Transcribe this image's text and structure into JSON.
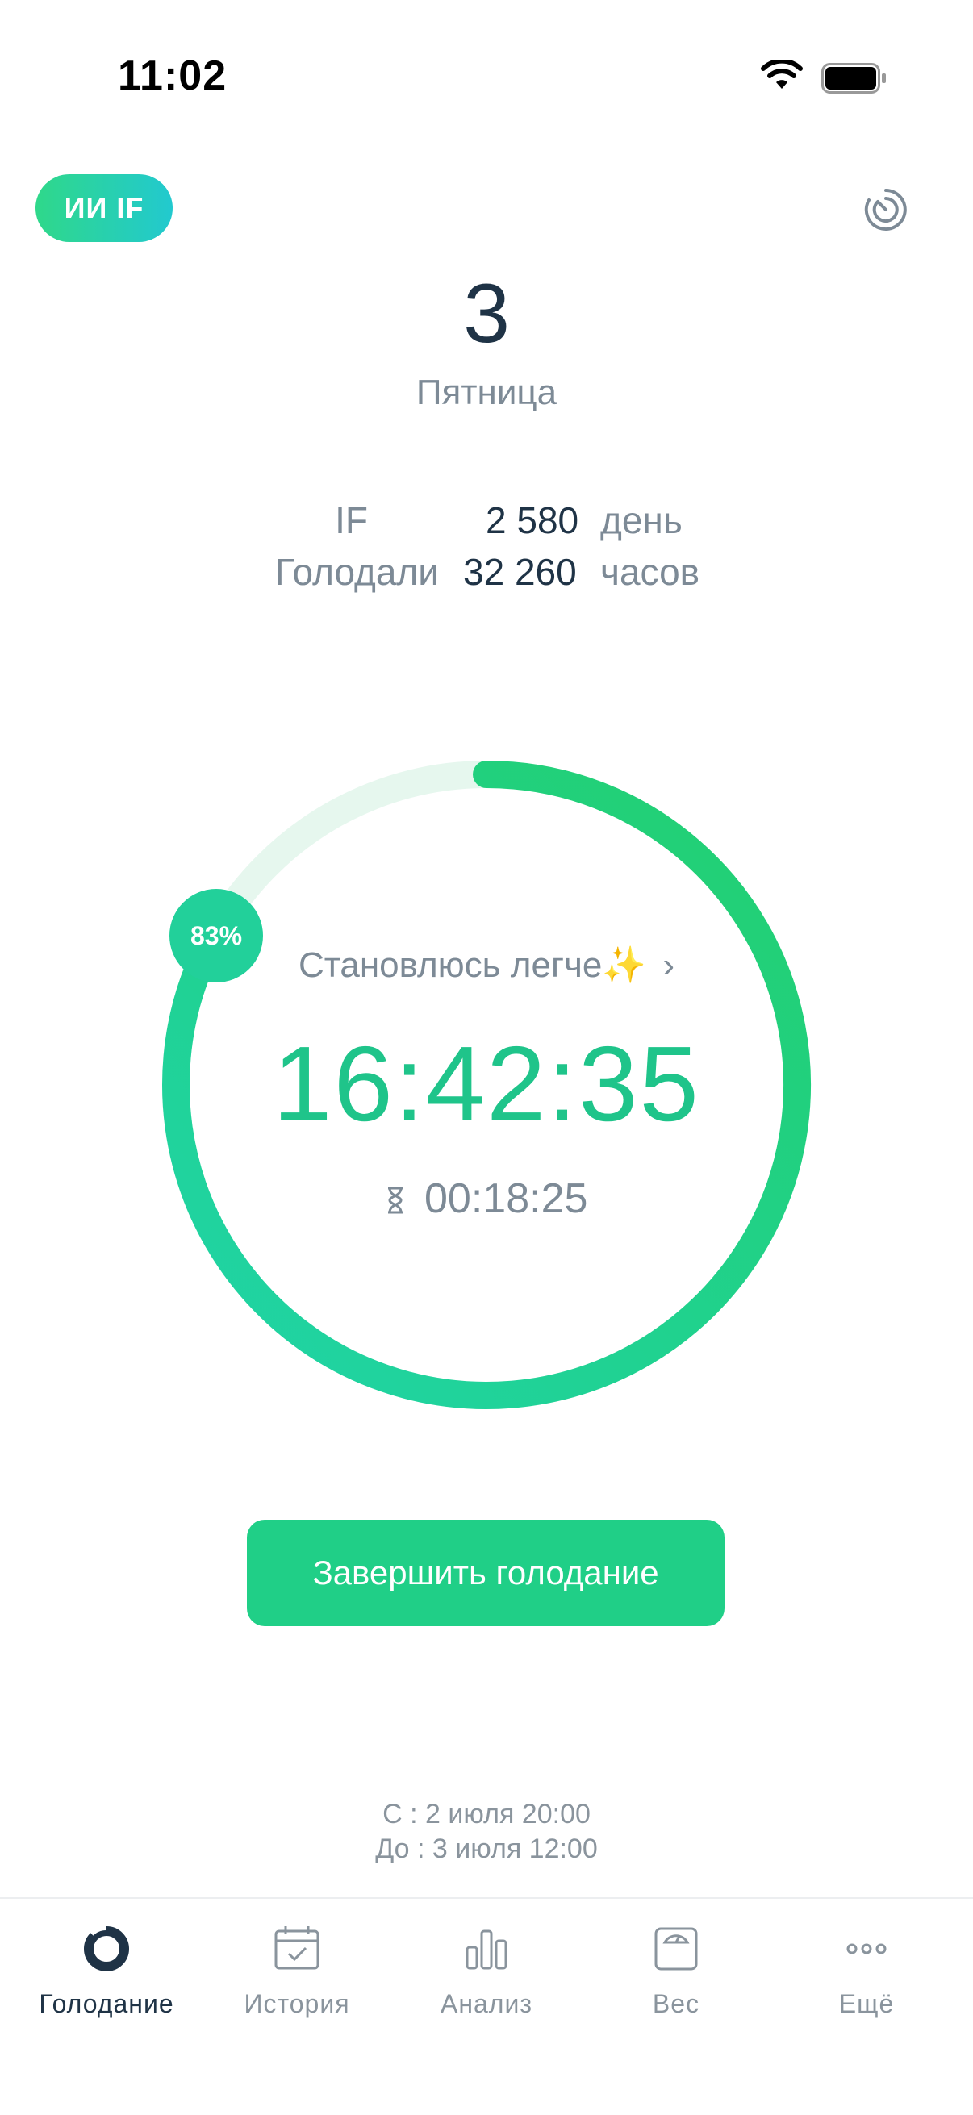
{
  "status_bar": {
    "time": "11:02"
  },
  "header": {
    "ai_badge": "ИИ IF",
    "history_icon": "history-timer-icon"
  },
  "day": {
    "number": "3",
    "weekday": "Пятница"
  },
  "stats": {
    "if_label": "IF",
    "if_value": "2 580",
    "if_unit": "день",
    "fasted_label": "Голодали",
    "fasted_value": "32 260",
    "fasted_unit": "часов"
  },
  "ring": {
    "percent_label": "83%",
    "progress": 0.83,
    "mood": "Становлюсь легче✨",
    "mood_chevron": "›",
    "elapsed": "16:42:35",
    "remaining": "00:18:25",
    "colors": {
      "start": "#1fd4a8",
      "end": "#22cf6f",
      "track": "#e6f7ee"
    }
  },
  "end_button": "Завершить голодание",
  "period": {
    "from": "С : 2 июля 20:00",
    "to": "До : 3 июля 12:00"
  },
  "tabs": [
    {
      "label": "Голодание",
      "icon": "fasting-ring-icon",
      "active": true
    },
    {
      "label": "История",
      "icon": "calendar-check-icon",
      "active": false
    },
    {
      "label": "Анализ",
      "icon": "bar-chart-icon",
      "active": false
    },
    {
      "label": "Вес",
      "icon": "scale-icon",
      "active": false
    },
    {
      "label": "Ещё",
      "icon": "more-dots-icon",
      "active": false
    }
  ]
}
